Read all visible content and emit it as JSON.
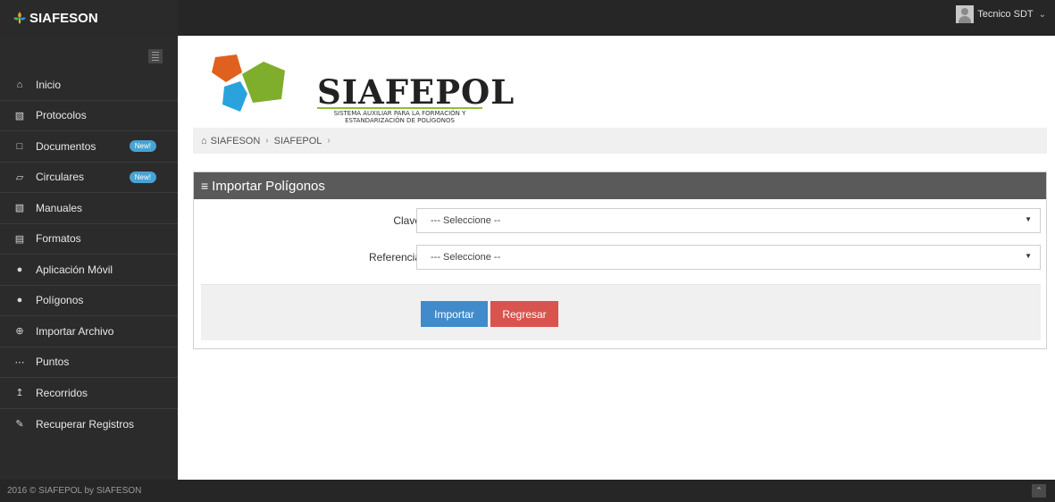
{
  "topbar": {
    "brand": "SIAFESON",
    "user_name": "Tecnico SDT",
    "user_chevron": "chevron-down-icon"
  },
  "sidebar": {
    "items": [
      {
        "label": "Inicio",
        "icon": "home-icon"
      },
      {
        "label": "Protocolos",
        "icon": "book-icon"
      },
      {
        "label": "Documentos",
        "icon": "folder-icon",
        "badge": "New!"
      },
      {
        "label": "Circulares",
        "icon": "folder-open-icon",
        "badge": "New!"
      },
      {
        "label": "Manuales",
        "icon": "book-icon"
      },
      {
        "label": "Formatos",
        "icon": "file-icon"
      },
      {
        "label": "Aplicación Móvil",
        "icon": "android-icon"
      },
      {
        "label": "Polígonos",
        "icon": "circle-icon"
      },
      {
        "label": "Importar Archivo",
        "icon": "plus-circle-icon"
      },
      {
        "label": "Puntos",
        "icon": "spinner-icon"
      },
      {
        "label": "Recorridos",
        "icon": "arrow-up-icon"
      },
      {
        "label": "Recuperar Registros",
        "icon": "wrench-icon"
      }
    ]
  },
  "logo": {
    "title": "SIAFEPOL",
    "subtitle_line1": "SISTEMA AUXILIAR PARA LA FORMACIÓN Y",
    "subtitle_line2": "ESTANDARIZACIÓN DE POLÍGONOS",
    "colors": {
      "orange": "#e0601f",
      "green": "#7fad2c",
      "blue": "#2aa3dc"
    }
  },
  "breadcrumb": {
    "items": [
      "SIAFESON",
      "SIAFEPOL"
    ]
  },
  "panel": {
    "title": "Importar Polígonos",
    "fields": [
      {
        "label": "Clave",
        "value": "--- Seleccione --"
      },
      {
        "label": "Referencia",
        "value": "--- Seleccione --"
      }
    ],
    "import_button": "Importar",
    "back_button": "Regresar"
  },
  "footer": {
    "text": "2016 © SIAFEPOL by SIAFESON"
  },
  "colors": {
    "primary": "#428bca",
    "danger": "#d9534f",
    "badge": "#47a3d3",
    "sidebar": "#2b2b2b"
  }
}
